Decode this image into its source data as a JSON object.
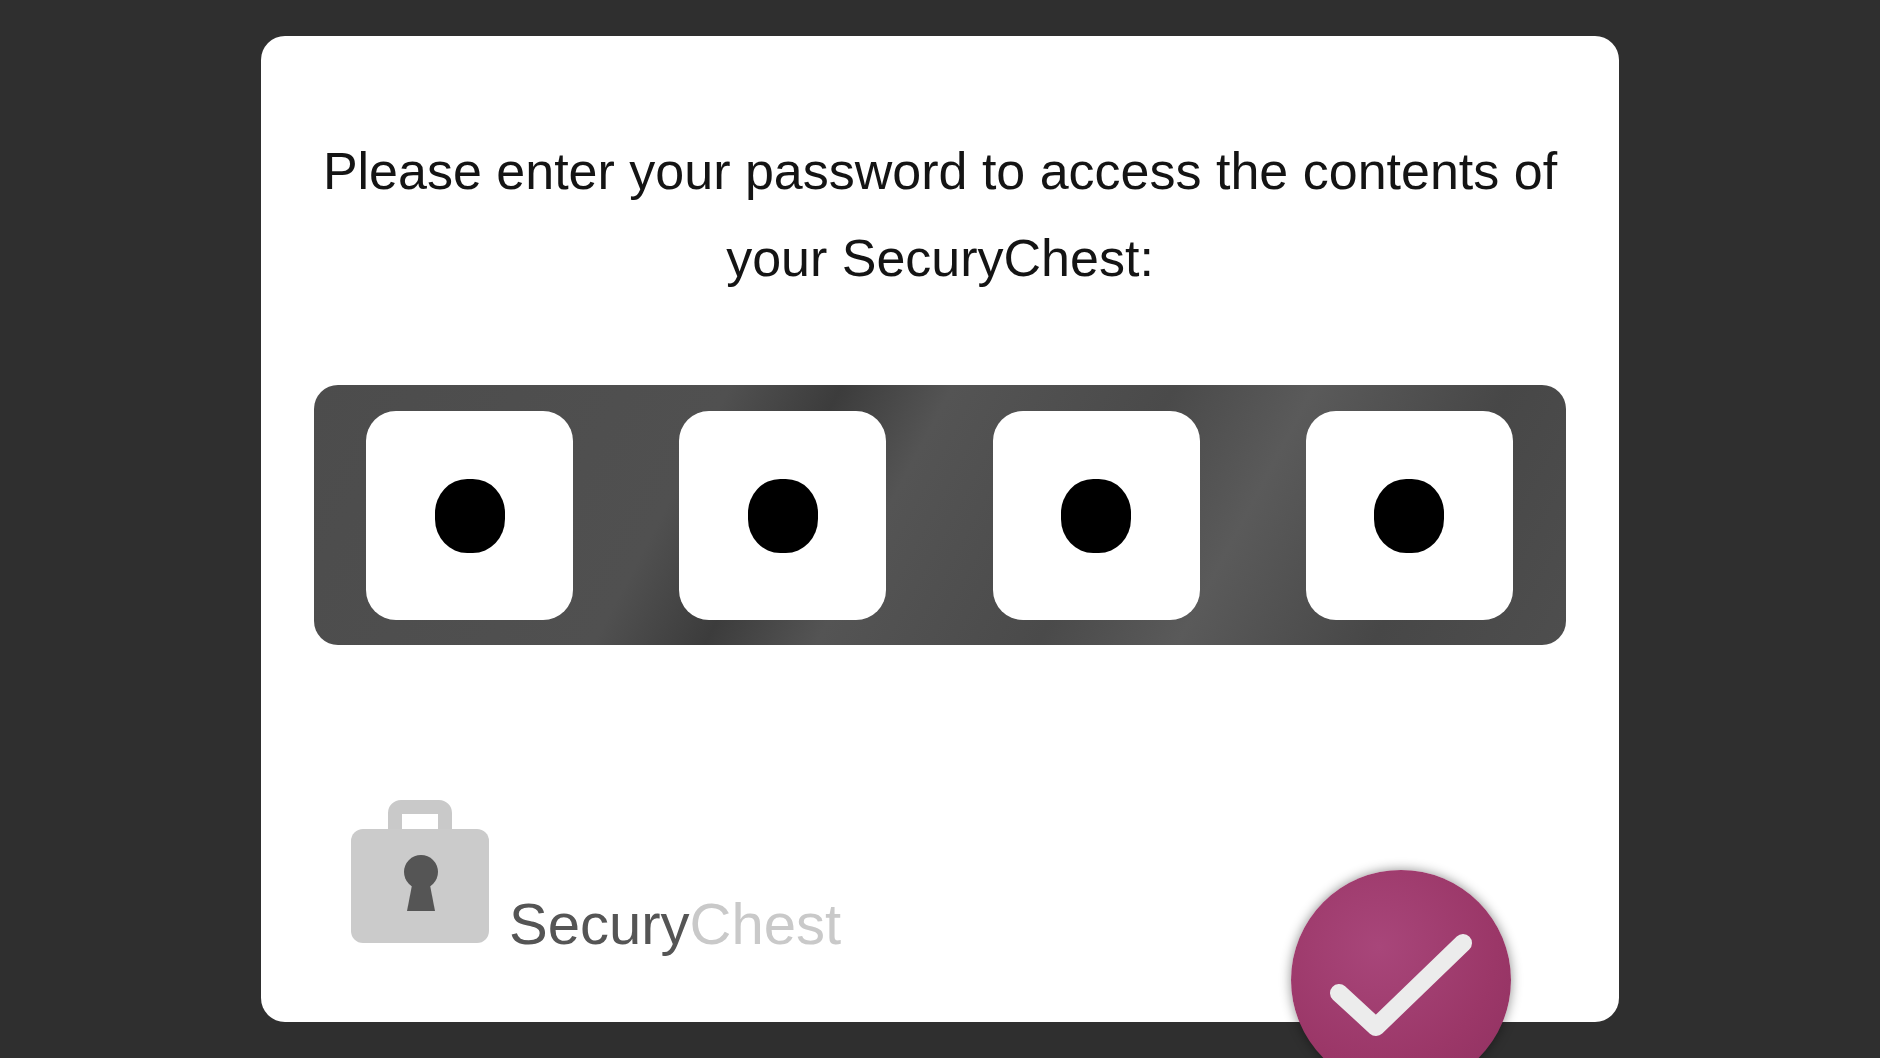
{
  "prompt": "Please enter your password to access the contents of your SecuryChest:",
  "pin_fields": [
    {
      "filled": true
    },
    {
      "filled": true
    },
    {
      "filled": true
    },
    {
      "filled": true
    }
  ],
  "logo": {
    "primary": "Secury",
    "secondary": "Chest"
  }
}
